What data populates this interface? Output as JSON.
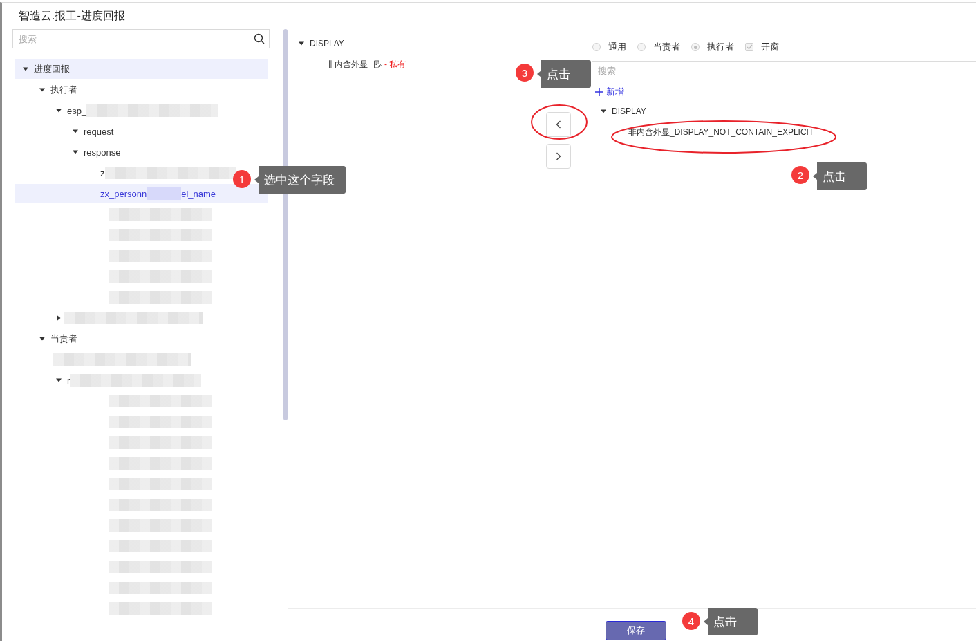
{
  "title": "智造云.报工-进度回报",
  "search": {
    "placeholder": "搜索"
  },
  "tree": [
    {
      "kind": "node",
      "label": "进度回报",
      "expanded": true,
      "hovered": true,
      "selected": false,
      "children": [
        {
          "kind": "node",
          "label": "执行者",
          "expanded": true,
          "selected": false,
          "children": [
            {
              "kind": "node",
              "label": "esp_",
              "blurred": true,
              "expanded": true,
              "selected": false,
              "children": [
                {
                  "kind": "node",
                  "label": "request",
                  "expanded": true,
                  "selected": false
                },
                {
                  "kind": "node",
                  "label": "response",
                  "expanded": true,
                  "selected": false,
                  "children": [
                    {
                      "kind": "leaf",
                      "label": "z",
                      "blurred": true,
                      "selected": false
                    },
                    {
                      "kind": "leaf",
                      "label": "zx_personn",
                      "suffix": "el_name",
                      "selected": true
                    },
                    {
                      "kind": "blurred"
                    },
                    {
                      "kind": "blurred"
                    },
                    {
                      "kind": "blurred"
                    },
                    {
                      "kind": "blurred"
                    },
                    {
                      "kind": "blurred"
                    }
                  ]
                }
              ]
            },
            {
              "kind": "blurred",
              "expanded": false
            }
          ]
        },
        {
          "kind": "node",
          "label": "当责者",
          "expanded": true,
          "selected": false,
          "children": [
            {
              "kind": "blurred"
            },
            {
              "kind": "node",
              "label": "r",
              "blurred": true,
              "expanded": true,
              "selected": false,
              "children": [
                {
                  "kind": "blurred"
                },
                {
                  "kind": "blurred"
                },
                {
                  "kind": "blurred"
                },
                {
                  "kind": "blurred"
                },
                {
                  "kind": "blurred"
                },
                {
                  "kind": "blurred"
                },
                {
                  "kind": "blurred"
                },
                {
                  "kind": "blurred"
                },
                {
                  "kind": "blurred"
                },
                {
                  "kind": "blurred"
                },
                {
                  "kind": "blurred"
                }
              ]
            }
          ]
        }
      ]
    }
  ],
  "middle": {
    "tree": [
      {
        "label": "DISPLAY",
        "expanded": true,
        "children": [
          {
            "label": "非内含外显",
            "tag": "- 私有"
          }
        ]
      }
    ]
  },
  "right": {
    "options": [
      {
        "kind": "radio",
        "label": "通用",
        "selected": false
      },
      {
        "kind": "radio",
        "label": "当责者",
        "selected": false
      },
      {
        "kind": "radio",
        "label": "执行者",
        "selected": true
      },
      {
        "kind": "checkbox",
        "label": "开窗",
        "checked": true
      }
    ],
    "search": {
      "placeholder": "搜索"
    },
    "add_button": "新增",
    "tree": [
      {
        "label": "DISPLAY",
        "expanded": true,
        "children": [
          {
            "label": "非内含外显_DISPLAY_NOT_CONTAIN_EXPLICIT"
          }
        ]
      }
    ]
  },
  "save_button": "保存",
  "annotations": [
    {
      "number": "1",
      "text": "选中这个字段"
    },
    {
      "number": "2",
      "text": "点击"
    },
    {
      "number": "3",
      "text": "点击"
    },
    {
      "number": "4",
      "text": "点击"
    }
  ]
}
